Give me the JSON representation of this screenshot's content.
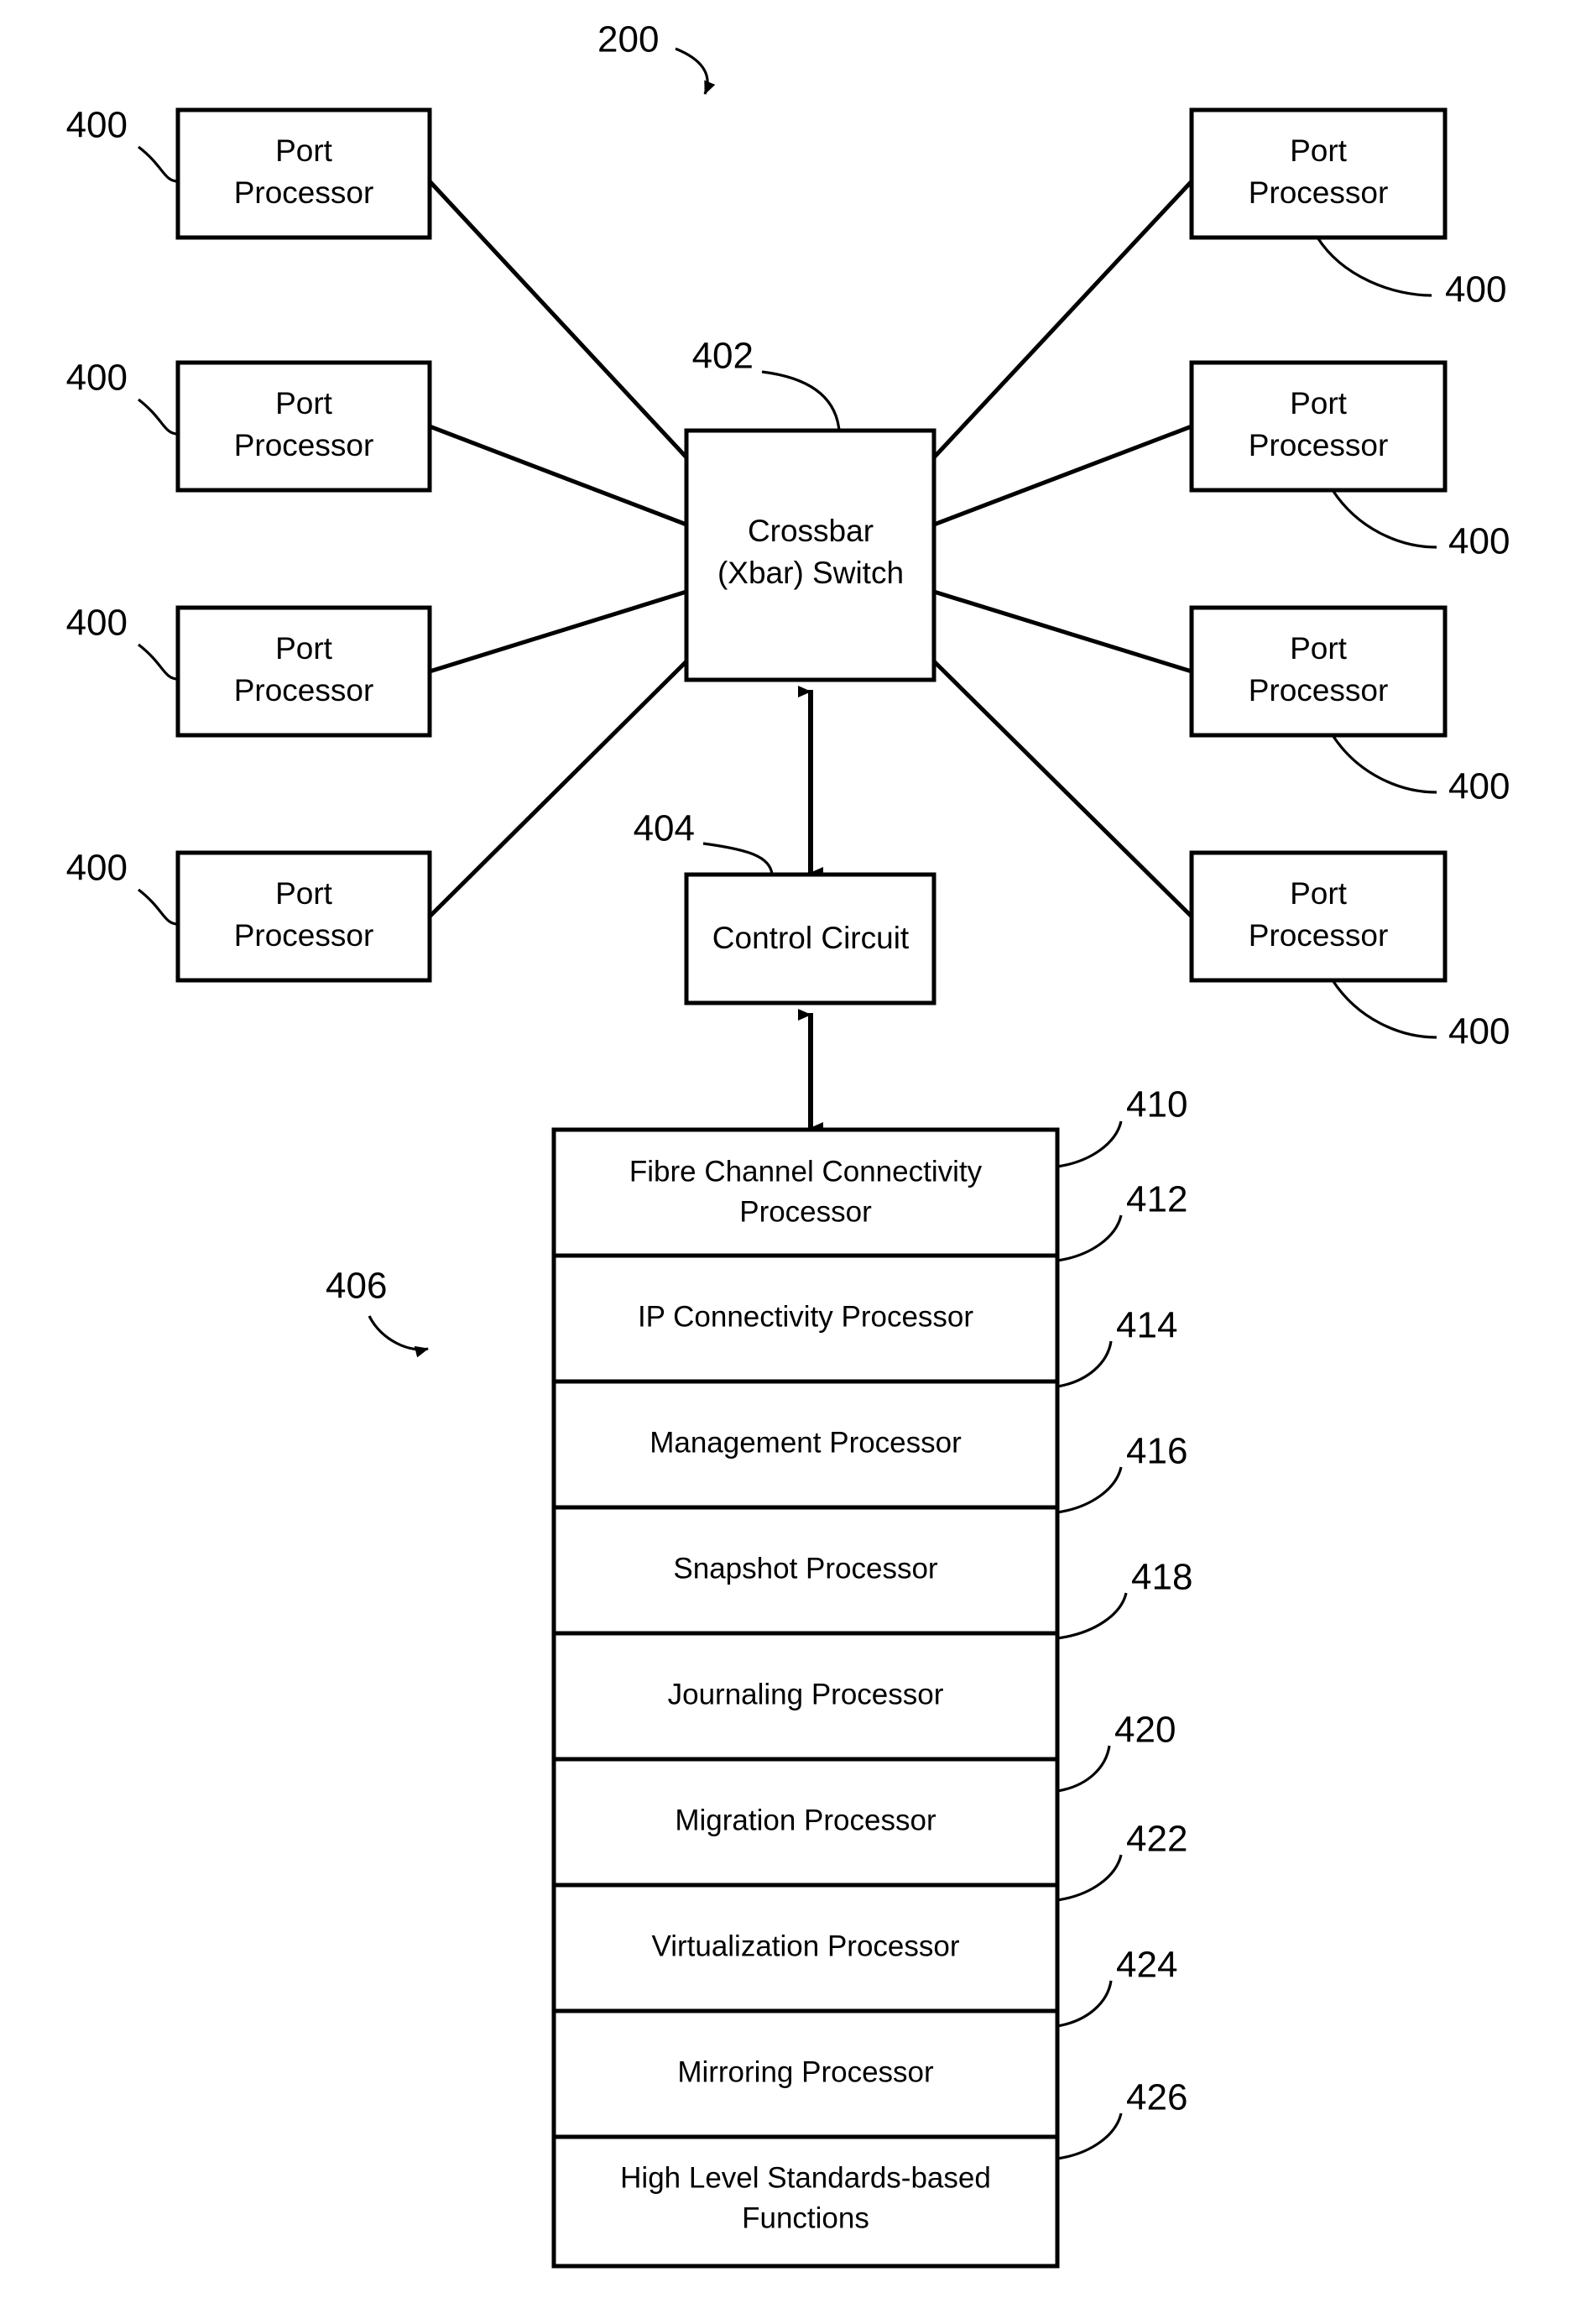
{
  "figure": {
    "figure_ref": "200",
    "background_color": "#ffffff",
    "line_color": "#000000"
  },
  "port_processors": {
    "label": "Port Processor",
    "line1": "Port",
    "line2": "Processor",
    "ref": "400",
    "left_column": [
      {
        "ref": "400",
        "line1": "Port",
        "line2": "Processor"
      },
      {
        "ref": "400",
        "line1": "Port",
        "line2": "Processor"
      },
      {
        "ref": "400",
        "line1": "Port",
        "line2": "Processor"
      },
      {
        "ref": "400",
        "line1": "Port",
        "line2": "Processor"
      }
    ],
    "right_column": [
      {
        "ref": "400",
        "line1": "Port",
        "line2": "Processor"
      },
      {
        "ref": "400",
        "line1": "Port",
        "line2": "Processor"
      },
      {
        "ref": "400",
        "line1": "Port",
        "line2": "Processor"
      },
      {
        "ref": "400",
        "line1": "Port",
        "line2": "Processor"
      }
    ]
  },
  "crossbar": {
    "line1": "Crossbar",
    "line2": "(Xbar) Switch",
    "ref": "402"
  },
  "control_circuit": {
    "label": "Control Circuit",
    "ref": "404"
  },
  "processor_stack": {
    "ref": "406",
    "rows": [
      {
        "ref": "410",
        "line1": "Fibre Channel Connectivity",
        "line2": "Processor"
      },
      {
        "ref": "412",
        "line1": "IP Connectivity Processor",
        "line2": ""
      },
      {
        "ref": "414",
        "line1": "Management Processor",
        "line2": ""
      },
      {
        "ref": "416",
        "line1": "Snapshot Processor",
        "line2": ""
      },
      {
        "ref": "418",
        "line1": "Journaling Processor",
        "line2": ""
      },
      {
        "ref": "420",
        "line1": "Migration Processor",
        "line2": ""
      },
      {
        "ref": "422",
        "line1": "Virtualization Processor",
        "line2": ""
      },
      {
        "ref": "424",
        "line1": "Mirroring Processor",
        "line2": ""
      },
      {
        "ref": "426",
        "line1": "High Level Standards-based",
        "line2": "Functions"
      }
    ]
  }
}
